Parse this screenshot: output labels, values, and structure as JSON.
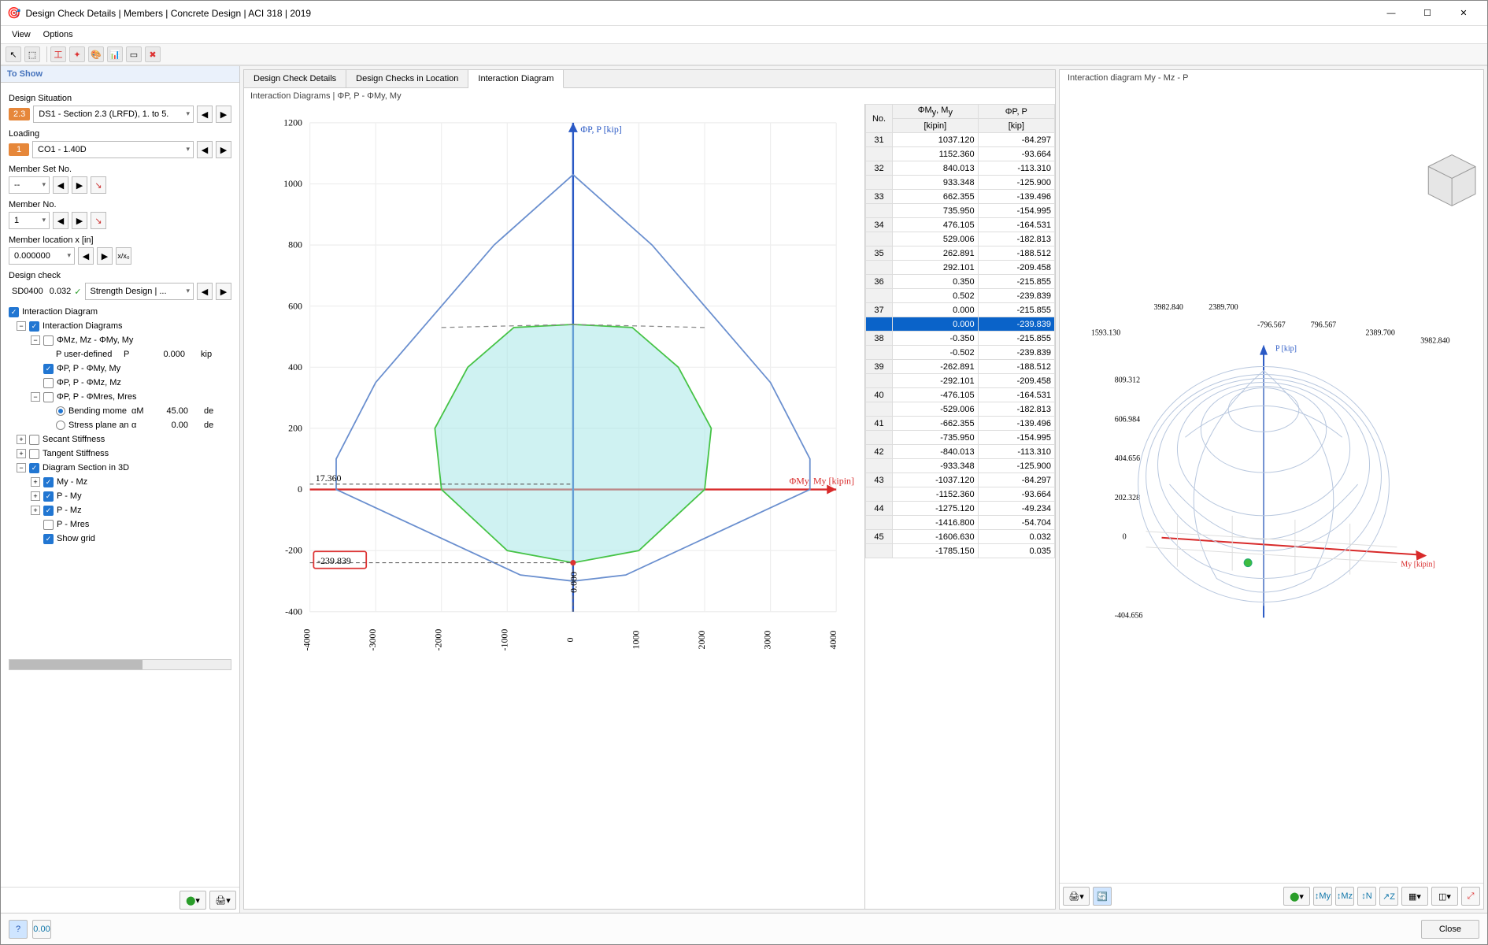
{
  "window": {
    "title": "Design Check Details | Members | Concrete Design | ACI 318 | 2019"
  },
  "menu": {
    "view": "View",
    "options": "Options"
  },
  "left": {
    "header": "To Show",
    "design_situation_label": "Design Situation",
    "design_situation_tag": "2.3",
    "design_situation_value": "DS1 - Section 2.3 (LRFD), 1. to 5.",
    "loading_label": "Loading",
    "loading_tag": "1",
    "loading_value": "CO1 - 1.40D",
    "member_set_label": "Member Set No.",
    "member_set_value": "--",
    "member_no_label": "Member No.",
    "member_no_value": "1",
    "member_loc_label": "Member location x [in]",
    "member_loc_value": "0.000000",
    "design_check_label": "Design check",
    "design_check_code": "SD0400",
    "design_check_ratio": "0.032",
    "design_check_name": "Strength Design | ...",
    "tree": {
      "interaction_diagram": "Interaction Diagram",
      "interaction_diagrams": "Interaction Diagrams",
      "phi_mz_mz": "ΦMz, Mz - ΦMy, My",
      "p_user_defined": "P user-defined",
      "p_user_defined_sym": "P",
      "p_user_defined_val": "0.000",
      "p_user_defined_unit": "kip",
      "phi_p_p_my": "ΦP, P - ΦMy, My",
      "phi_p_p_mz": "ΦP, P - ΦMz, Mz",
      "phi_p_p_mres": "ΦP, P - ΦMres, Mres",
      "bending_moment": "Bending mome",
      "bending_moment_sym": "αM",
      "bending_moment_val": "45.00",
      "bending_moment_unit": "de",
      "stress_plane": "Stress plane an",
      "stress_plane_sym": "α",
      "stress_plane_val": "0.00",
      "stress_plane_unit": "de",
      "secant": "Secant Stiffness",
      "tangent": "Tangent Stiffness",
      "diagram3d": "Diagram Section in 3D",
      "my_mz": "My - Mz",
      "p_my": "P - My",
      "p_mz": "P - Mz",
      "p_mres": "P - Mres",
      "show_grid": "Show grid"
    }
  },
  "middle": {
    "tabs": {
      "t1": "Design Check Details",
      "t2": "Design Checks in Location",
      "t3": "Interaction Diagram"
    },
    "subtitle": "Interaction Diagrams | ΦP, P - ΦMy, My",
    "col_no": "No.",
    "col_my": "ΦMy, My\n[kipin]",
    "col_p": "ΦP, P\n[kip]",
    "rows": [
      {
        "no": "31",
        "my": "1037.120",
        "p": "-84.297"
      },
      {
        "no": "",
        "my": "1152.360",
        "p": "-93.664"
      },
      {
        "no": "32",
        "my": "840.013",
        "p": "-113.310"
      },
      {
        "no": "",
        "my": "933.348",
        "p": "-125.900"
      },
      {
        "no": "33",
        "my": "662.355",
        "p": "-139.496"
      },
      {
        "no": "",
        "my": "735.950",
        "p": "-154.995"
      },
      {
        "no": "34",
        "my": "476.105",
        "p": "-164.531"
      },
      {
        "no": "",
        "my": "529.006",
        "p": "-182.813"
      },
      {
        "no": "35",
        "my": "262.891",
        "p": "-188.512"
      },
      {
        "no": "",
        "my": "292.101",
        "p": "-209.458"
      },
      {
        "no": "36",
        "my": "0.350",
        "p": "-215.855"
      },
      {
        "no": "",
        "my": "0.502",
        "p": "-239.839"
      },
      {
        "no": "37",
        "my": "0.000",
        "p": "-215.855"
      },
      {
        "no": "",
        "my": "0.000",
        "p": "-239.839",
        "selected": true
      },
      {
        "no": "38",
        "my": "-0.350",
        "p": "-215.855"
      },
      {
        "no": "",
        "my": "-0.502",
        "p": "-239.839"
      },
      {
        "no": "39",
        "my": "-262.891",
        "p": "-188.512"
      },
      {
        "no": "",
        "my": "-292.101",
        "p": "-209.458"
      },
      {
        "no": "40",
        "my": "-476.105",
        "p": "-164.531"
      },
      {
        "no": "",
        "my": "-529.006",
        "p": "-182.813"
      },
      {
        "no": "41",
        "my": "-662.355",
        "p": "-139.496"
      },
      {
        "no": "",
        "my": "-735.950",
        "p": "-154.995"
      },
      {
        "no": "42",
        "my": "-840.013",
        "p": "-113.310"
      },
      {
        "no": "",
        "my": "-933.348",
        "p": "-125.900"
      },
      {
        "no": "43",
        "my": "-1037.120",
        "p": "-84.297"
      },
      {
        "no": "",
        "my": "-1152.360",
        "p": "-93.664"
      },
      {
        "no": "44",
        "my": "-1275.120",
        "p": "-49.234"
      },
      {
        "no": "",
        "my": "-1416.800",
        "p": "-54.704"
      },
      {
        "no": "45",
        "my": "-1606.630",
        "p": "0.032"
      },
      {
        "no": "",
        "my": "-1785.150",
        "p": "0.035"
      }
    ]
  },
  "right": {
    "title": "Interaction diagram My - Mz - P",
    "axis_p": "P [kip]",
    "axis_my": "My [kipin]",
    "ticks_p": [
      "-404.656",
      "0",
      "202.328",
      "404.656",
      "606.984",
      "809.312"
    ],
    "ticks_top": [
      "1593.130",
      "3982.840",
      "2389.700",
      "-796.567",
      "796.567",
      "2389.700",
      "3982.840"
    ]
  },
  "close_label": "Close",
  "chart_data": {
    "type": "scatter-line",
    "title": "ΦP, P - ΦMy, My",
    "xlabel": "ΦMy, My [kipin]",
    "ylabel": "ΦP, P [kip]",
    "xlim": [
      -4000,
      4000
    ],
    "ylim": [
      -400,
      1200
    ],
    "xticks": [
      -4000,
      -3000,
      -2000,
      -1000,
      0,
      1000,
      2000,
      3000,
      4000
    ],
    "yticks": [
      -400,
      -200,
      0,
      200,
      400,
      600,
      800,
      1000,
      1200
    ],
    "annotations": [
      {
        "text": "17.360",
        "x": -3700,
        "y": 20
      },
      {
        "text": "-239.839",
        "x": -3600,
        "y": -239.839,
        "boxed": true
      },
      {
        "text": "0.000",
        "x": 0,
        "y": -350,
        "rotated": true
      }
    ],
    "series": [
      {
        "name": "outer",
        "color": "#6a8fcf",
        "points": [
          [
            0,
            1030
          ],
          [
            1200,
            800
          ],
          [
            2200,
            550
          ],
          [
            3000,
            350
          ],
          [
            3600,
            100
          ],
          [
            3600,
            0
          ],
          [
            800,
            -280
          ],
          [
            0,
            -300
          ],
          [
            -800,
            -280
          ],
          [
            -3600,
            0
          ],
          [
            -3600,
            100
          ],
          [
            -3000,
            350
          ],
          [
            -2200,
            550
          ],
          [
            -1200,
            800
          ],
          [
            0,
            1030
          ]
        ]
      },
      {
        "name": "inner",
        "color": "#46c346",
        "fill": "rgba(160,230,230,0.5)",
        "points": [
          [
            0,
            540
          ],
          [
            900,
            530
          ],
          [
            1600,
            400
          ],
          [
            2100,
            200
          ],
          [
            2000,
            0
          ],
          [
            1000,
            -200
          ],
          [
            0,
            -240
          ],
          [
            -1000,
            -200
          ],
          [
            -2000,
            0
          ],
          [
            -2100,
            200
          ],
          [
            -1600,
            400
          ],
          [
            -900,
            530
          ],
          [
            0,
            540
          ]
        ]
      }
    ],
    "highlight_point": {
      "x": 0,
      "y": -239.839
    }
  }
}
